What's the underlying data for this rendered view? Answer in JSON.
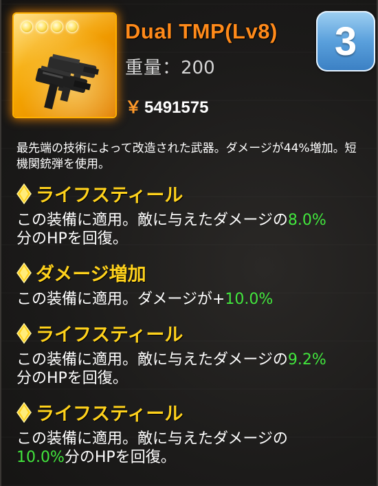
{
  "item": {
    "name": "Dual TMP(Lv8)",
    "star_count": 4,
    "weight_label": "重量：",
    "weight_value": "200",
    "price_symbol": "￥",
    "price_value": "5491575",
    "rank": "3",
    "icon": "smg-gun-icon",
    "card_color": "#f3a100"
  },
  "description": "最先端の技術によって改造された武器。ダメージが44%増加。短機関銃弾を使用。",
  "abilities": [
    {
      "title": "ライフスティール",
      "desc_prefix": "この装備に適用。敵に与えたダメージの",
      "value": "8.0%",
      "desc_suffix": "分のHPを回復。"
    },
    {
      "title": "ダメージ増加",
      "desc_prefix": "この装備に適用。ダメージが+",
      "value": "10.0%",
      "desc_suffix": ""
    },
    {
      "title": "ライフスティール",
      "desc_prefix": "この装備に適用。敵に与えたダメージの",
      "value": "9.2%",
      "desc_suffix": "分のHPを回復。"
    },
    {
      "title": "ライフスティール",
      "desc_prefix": "この装備に適用。敵に与えたダメージの",
      "value": "10.0%",
      "desc_suffix": "分のHPを回復。"
    }
  ],
  "colors": {
    "title_orange": "#ff8a1a",
    "ability_yellow": "#ffd21c",
    "value_green": "#42e63d",
    "badge_blue": "#5aa0dc"
  }
}
